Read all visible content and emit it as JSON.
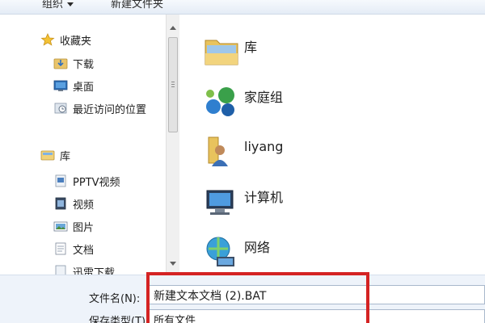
{
  "toolbar": {
    "organize_label": "组织",
    "new_folder_label": "新建文件夹"
  },
  "nav": {
    "favorites": [
      {
        "label": "收藏夹",
        "icon": "star-icon"
      },
      {
        "label": "下载",
        "icon": "download-folder-icon"
      },
      {
        "label": "桌面",
        "icon": "desktop-icon"
      },
      {
        "label": "最近访问的位置",
        "icon": "recent-places-icon"
      }
    ],
    "libraries": [
      {
        "label": "库",
        "icon": "library-icon"
      },
      {
        "label": "PPTV视频",
        "icon": "video-folder-icon"
      },
      {
        "label": "视频",
        "icon": "video-icon"
      },
      {
        "label": "图片",
        "icon": "pictures-icon"
      },
      {
        "label": "文档",
        "icon": "documents-icon"
      },
      {
        "label": "迅雷下载",
        "icon": "download-folder-icon"
      }
    ]
  },
  "content": {
    "items": [
      {
        "label": "库",
        "icon": "library-icon"
      },
      {
        "label": "家庭组",
        "icon": "homegroup-icon"
      },
      {
        "label": "liyang",
        "icon": "user-folder-icon"
      },
      {
        "label": "计算机",
        "icon": "computer-icon"
      },
      {
        "label": "网络",
        "icon": "network-icon"
      }
    ]
  },
  "filename": {
    "label": "文件名(N):",
    "value": "新建文本文档 (2).BAT"
  },
  "filetype": {
    "label": "保存类型(T):",
    "value": "所有文件"
  },
  "colors": {
    "highlight": "#d42323",
    "bottom_bg": "#eef3fa"
  }
}
